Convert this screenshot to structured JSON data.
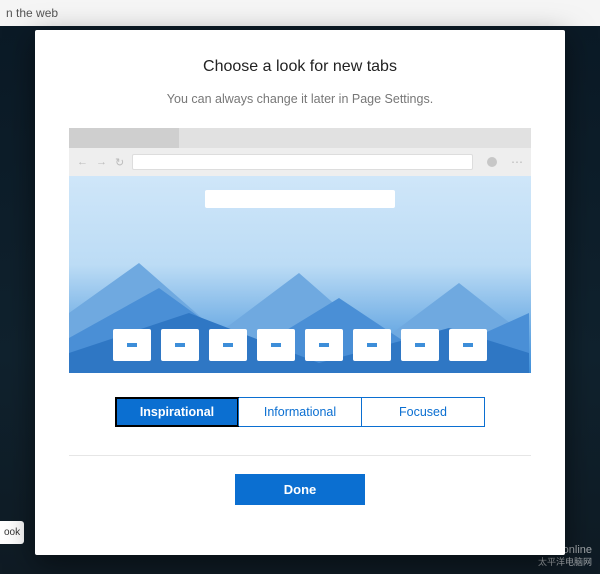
{
  "background": {
    "toolbar_fragment": "n the web",
    "side_label": "ook",
    "watermark_main": "PConline",
    "watermark_sub": "太平洋电脑网"
  },
  "modal": {
    "title": "Choose a look for new tabs",
    "subtitle": "You can always change it later in Page Settings.",
    "options": {
      "inspirational": "Inspirational",
      "informational": "Informational",
      "focused": "Focused"
    },
    "done_label": "Done"
  }
}
